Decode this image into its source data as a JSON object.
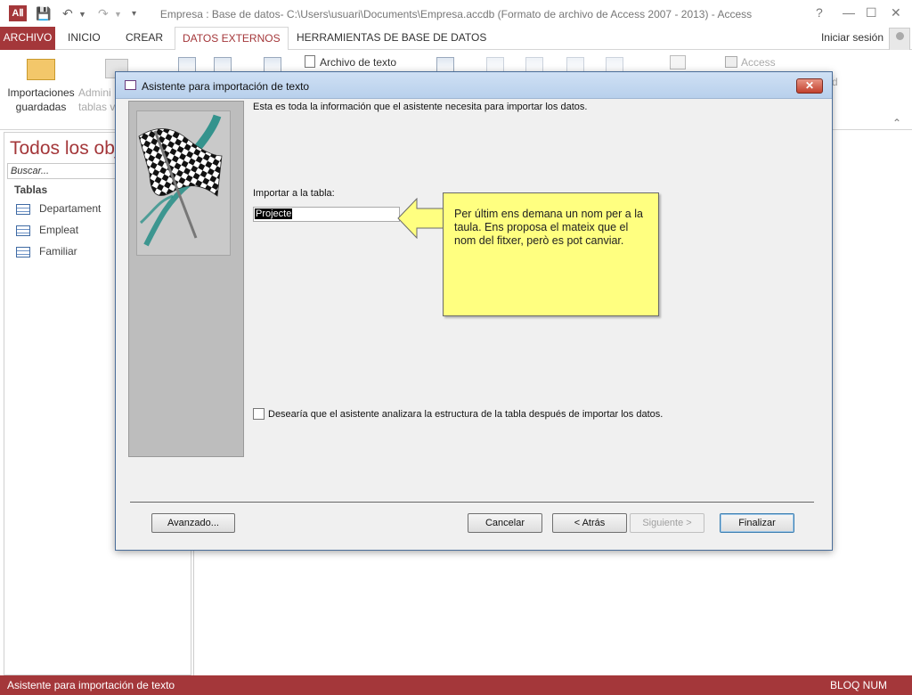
{
  "window": {
    "app_logo": "AⅡ",
    "title": "Empresa : Base de datos- C:\\Users\\usuari\\Documents\\Empresa.accdb (Formato de archivo de Access 2007 - 2013) - Access",
    "help": "?",
    "minimize": "—",
    "maximize": "☐",
    "close": "✕"
  },
  "ribbon": {
    "tabs": [
      "ARCHIVO",
      "INICIO",
      "CREAR",
      "DATOS EXTERNOS",
      "HERRAMIENTAS DE BASE DE DATOS"
    ],
    "active_tab": "DATOS EXTERNOS",
    "signin": "Iniciar sesión",
    "import_saved_line1": "Importaciones",
    "import_saved_line2": "guardadas",
    "admin_line1": "Admini",
    "admin_line2": "tablas v",
    "text_file": "Archivo de texto",
    "access": "Access",
    "partial_d": "d"
  },
  "nav": {
    "title": "Todos los obj",
    "search_placeholder": "Buscar...",
    "group": "Tablas",
    "items": [
      "Departament",
      "Empleat",
      "Familiar"
    ]
  },
  "dialog": {
    "title": "Asistente para importación de texto",
    "close": "✕",
    "intro": "Esta es toda la información que el asistente necesita para importar los datos.",
    "import_label": "Importar a la tabla:",
    "table_name": "Projecte",
    "analyze_label": "Desearía que el asistente analizara la estructura de la tabla después de importar los datos.",
    "analyze_checked": false,
    "buttons": {
      "advanced": "Avanzado...",
      "cancel": "Cancelar",
      "back": "< Atrás",
      "next": "Siguiente >",
      "finish": "Finalizar"
    }
  },
  "callout": {
    "text": "Per últim ens demana un nom per a la taula. Ens proposa el mateix que el nom del fitxer, però es pot canviar."
  },
  "statusbar": {
    "left": "Asistente para importación de texto",
    "right": "BLOQ NUM"
  },
  "colors": {
    "accent": "#a4373a",
    "callout_fill": "#ffff80",
    "dialog_bg": "#f0f0f0"
  }
}
